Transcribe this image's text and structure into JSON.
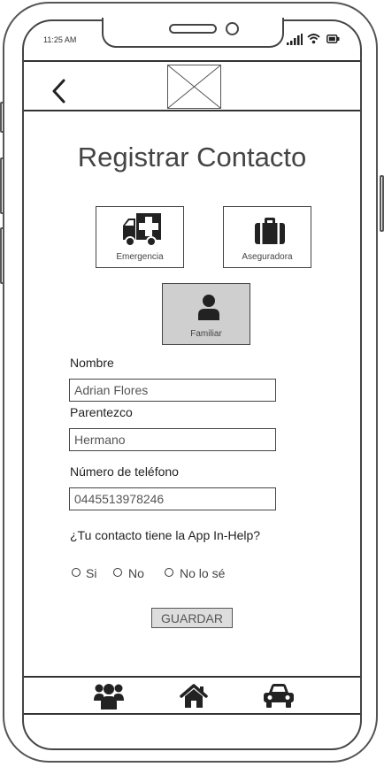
{
  "status_bar": {
    "time": "11:25 AM"
  },
  "header": {
    "back_icon": "chevron-left-icon",
    "logo": "image-placeholder-icon"
  },
  "page": {
    "title": "Registrar Contacto"
  },
  "categories": [
    {
      "label": "Emergencia",
      "icon": "ambulance-icon",
      "selected": false
    },
    {
      "label": "Aseguradora",
      "icon": "briefcase-icon",
      "selected": false
    },
    {
      "label": "Familiar",
      "icon": "person-icon",
      "selected": true
    }
  ],
  "form": {
    "name": {
      "label": "Nombre",
      "value": "Adrian Flores"
    },
    "relationship": {
      "label": "Parentezco",
      "value": "Hermano"
    },
    "phone": {
      "label": "Número de teléfono",
      "value": "0445513978246"
    },
    "app_question": {
      "label": "¿Tu contacto tiene la App In-Help?",
      "options": [
        "Si",
        "No",
        "No lo sé"
      ]
    },
    "save_label": "GUARDAR"
  },
  "bottom_nav": [
    {
      "icon": "group-icon"
    },
    {
      "icon": "home-icon"
    },
    {
      "icon": "car-icon"
    }
  ],
  "colors": {
    "frame": "#444444",
    "selected_card": "#cfcfcf",
    "button_bg": "#dddddd"
  }
}
